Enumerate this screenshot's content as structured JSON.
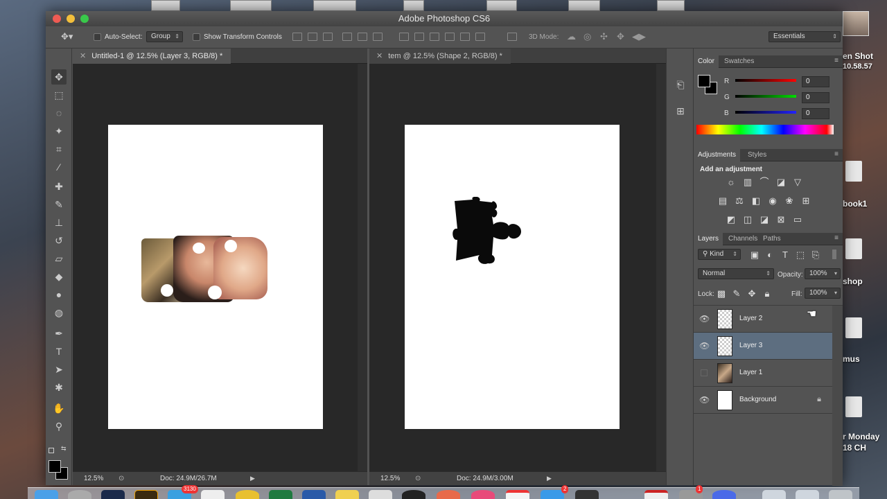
{
  "window": {
    "title": "Adobe Photoshop CS6"
  },
  "options": {
    "auto_select_label": "Auto-Select:",
    "auto_select_value": "Group",
    "transform_label": "Show Transform Controls",
    "mode3d_label": "3D Mode:",
    "workspace": "Essentials"
  },
  "documents": [
    {
      "tab": "Untitled-1 @ 12.5% (Layer 3, RGB/8) *",
      "zoom": "12.5%",
      "doc_info": "Doc: 24.9M/26.7M"
    },
    {
      "tab": "tem @ 12.5% (Shape 2, RGB/8) *",
      "zoom": "12.5%",
      "doc_info": "Doc: 24.9M/3.00M"
    }
  ],
  "color_panel": {
    "tabs": [
      "Color",
      "Swatches"
    ],
    "r_label": "R",
    "g_label": "G",
    "b_label": "B",
    "r": "0",
    "g": "0",
    "b": "0"
  },
  "adjustments_panel": {
    "tabs": [
      "Adjustments",
      "Styles"
    ],
    "heading": "Add an adjustment"
  },
  "layers_panel": {
    "tabs": [
      "Layers",
      "Channels",
      "Paths"
    ],
    "filter": "Kind",
    "blend_mode": "Normal",
    "opacity_label": "Opacity:",
    "opacity": "100%",
    "lock_label": "Lock:",
    "fill_label": "Fill:",
    "fill": "100%",
    "layers": [
      {
        "name": "Layer 2"
      },
      {
        "name": "Layer 3"
      },
      {
        "name": "Layer 1"
      },
      {
        "name": "Background"
      }
    ]
  },
  "desktop": {
    "labels": [
      "en Shot",
      "10.58.57",
      "book1",
      "shop",
      "mus",
      "r Monday",
      "18 CH"
    ]
  },
  "dock": {
    "badges": [
      "3130",
      "2",
      "1"
    ]
  }
}
